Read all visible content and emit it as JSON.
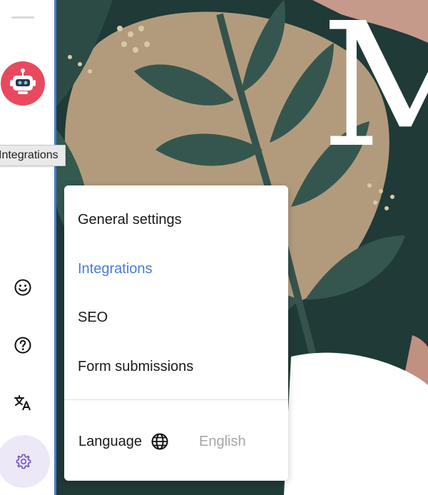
{
  "tooltip": {
    "text": "Integrations"
  },
  "menu": {
    "items": [
      {
        "label": "General settings",
        "active": false
      },
      {
        "label": "Integrations",
        "active": true
      },
      {
        "label": "SEO",
        "active": false
      },
      {
        "label": "Form submissions",
        "active": false
      }
    ],
    "language": {
      "label": "Language",
      "value": "English",
      "icon": "globe-icon"
    }
  },
  "hero": {
    "letter": "M"
  },
  "sidebar": {
    "icons": [
      "robot-icon",
      "smiley-icon",
      "help-icon",
      "translate-icon",
      "gear-icon"
    ]
  },
  "colors": {
    "accent": "#4a7bd6",
    "avatar": "#e9495e",
    "settings_bg": "#ece8f7",
    "settings_icon": "#6d52b8"
  }
}
